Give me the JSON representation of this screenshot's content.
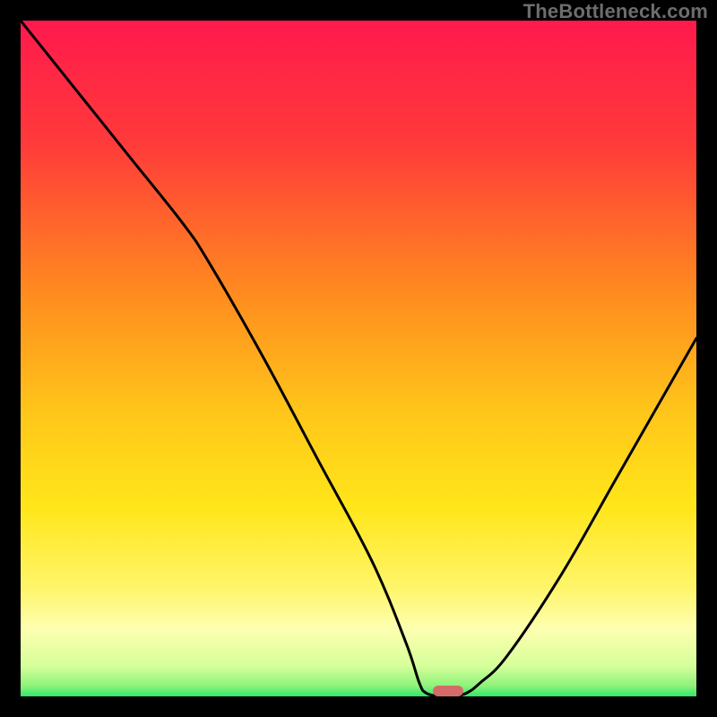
{
  "watermark": "TheBottleneck.com",
  "colors": {
    "frame": "#000000",
    "watermark": "#6d6d6d",
    "curve": "#000000",
    "marker": "#d46a6a",
    "gradient_stops": [
      {
        "offset": 0.0,
        "color": "#ff1a4d"
      },
      {
        "offset": 0.18,
        "color": "#ff3a3a"
      },
      {
        "offset": 0.4,
        "color": "#ff8a1f"
      },
      {
        "offset": 0.58,
        "color": "#ffc61a"
      },
      {
        "offset": 0.72,
        "color": "#ffe61a"
      },
      {
        "offset": 0.84,
        "color": "#fff56a"
      },
      {
        "offset": 0.9,
        "color": "#fdffb0"
      },
      {
        "offset": 0.955,
        "color": "#d6ff9a"
      },
      {
        "offset": 0.985,
        "color": "#8cf27a"
      },
      {
        "offset": 1.0,
        "color": "#2fe86a"
      }
    ]
  },
  "chart_data": {
    "type": "line",
    "title": "",
    "xlabel": "",
    "ylabel": "",
    "xlim": [
      0,
      100
    ],
    "ylim": [
      0,
      100
    ],
    "x": [
      0,
      8,
      16,
      24,
      28,
      36,
      44,
      52,
      57,
      59,
      60,
      62,
      64,
      66,
      68,
      72,
      80,
      88,
      96,
      100
    ],
    "values": [
      100,
      90,
      80,
      70,
      64,
      50,
      35,
      20,
      8,
      2,
      0.5,
      0,
      0,
      0.5,
      2,
      6,
      18,
      32,
      46,
      53
    ],
    "marker": {
      "x_range": [
        61,
        65.5
      ],
      "y": 0
    },
    "annotations": []
  }
}
